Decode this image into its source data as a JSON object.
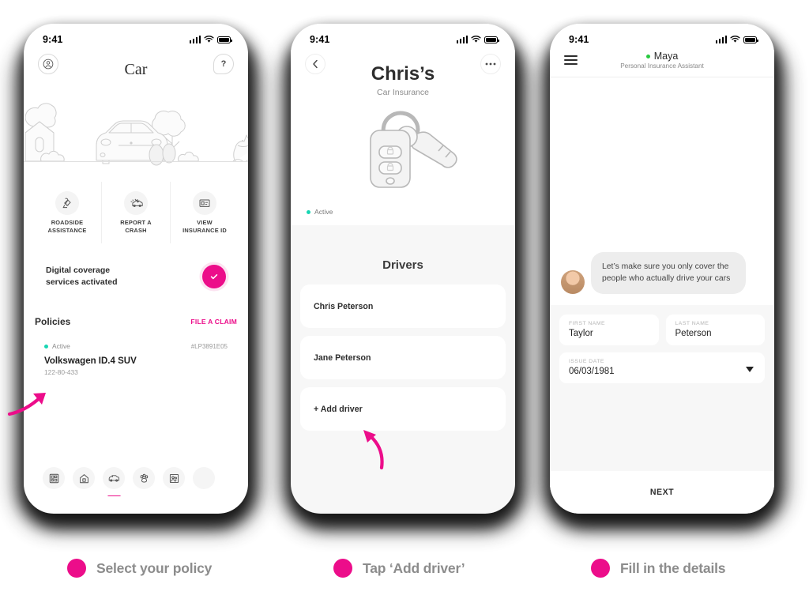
{
  "colors": {
    "accent": "#ec0d8a",
    "active_dot": "#18d6b3",
    "online_dot": "#27c93f",
    "screen_bg": "#f7f7f7"
  },
  "phone1": {
    "status": {
      "time": "9:41",
      "signal": "signal-bars-icon",
      "wifi": "wifi-icon",
      "battery": "battery-icon"
    },
    "profile_icon": "profile-icon",
    "help_icon": "question-mark-icon",
    "title": "Car",
    "illustration": "neighborhood-car-illustration",
    "actions": [
      {
        "icon": "roadside-assistance-icon",
        "label": "ROADSIDE\nASSISTANCE",
        "line1": "ROADSIDE",
        "line2": "ASSISTANCE"
      },
      {
        "icon": "crash-car-icon",
        "label": "REPORT A\nCRASH",
        "line1": "REPORT A",
        "line2": "CRASH"
      },
      {
        "icon": "insurance-id-card-icon",
        "label": "VIEW\nINSURANCE ID",
        "line1": "VIEW",
        "line2": "INSURANCE ID"
      }
    ],
    "digital": {
      "line1": "Digital coverage",
      "line2": "services activated",
      "check_icon": "check-icon"
    },
    "policies_header": "Policies",
    "file_claim": "FILE A CLAIM",
    "policy": {
      "status": "Active",
      "id": "#LP3891E05",
      "name": "Volkswagen ID.4 SUV",
      "number": "122-80-433"
    },
    "nav": [
      {
        "icon": "dashboard-grid-icon",
        "active": false
      },
      {
        "icon": "home-icon",
        "active": false
      },
      {
        "icon": "car-icon",
        "active": true
      },
      {
        "icon": "paw-icon",
        "active": false
      },
      {
        "icon": "family-photo-icon",
        "active": false
      },
      {
        "icon": "more-icon",
        "active": false
      }
    ]
  },
  "phone2": {
    "status": {
      "time": "9:41"
    },
    "back_icon": "chevron-left-icon",
    "more_icon": "ellipsis-icon",
    "title": "Chris’s",
    "subtitle": "Car Insurance",
    "illustration": "car-key-fob-illustration",
    "status_label": "Active",
    "drivers_header": "Drivers",
    "drivers": [
      {
        "name": "Chris Peterson"
      },
      {
        "name": "Jane Peterson"
      }
    ],
    "add_driver": "+  Add driver"
  },
  "phone3": {
    "status": {
      "time": "9:41"
    },
    "menu_icon": "hamburger-menu-icon",
    "assistant_name": "Maya",
    "assistant_role": "Personal Insurance Assistant",
    "avatar": "assistant-avatar",
    "message": "Let’s make sure you only cover the people who actually drive your cars",
    "fields": [
      {
        "label": "FIRST NAME",
        "value": "Taylor"
      },
      {
        "label": "LAST NAME",
        "value": "Peterson"
      },
      {
        "label": "ISSUE DATE",
        "value": "06/03/1981"
      }
    ],
    "next_label": "NEXT"
  },
  "captions": [
    {
      "text": "Select your policy"
    },
    {
      "text": "Tap ‘Add driver’"
    },
    {
      "text": "Fill in the details"
    }
  ]
}
